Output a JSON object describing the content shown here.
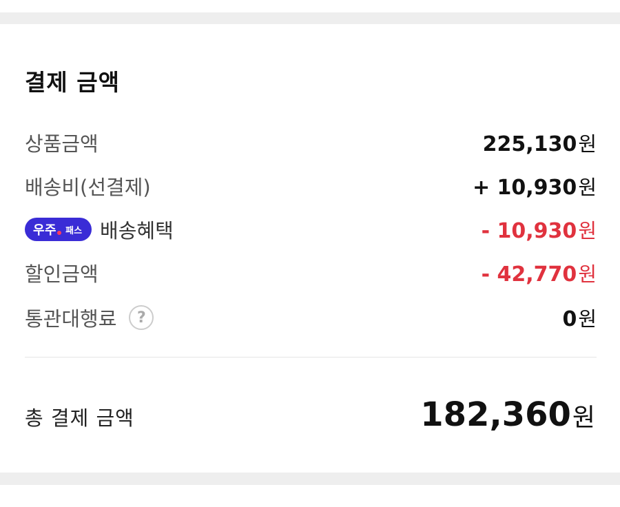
{
  "section_title": "결제 금액",
  "rows": [
    {
      "label": "상품금액",
      "amount": "225,130",
      "unit": "원"
    },
    {
      "label": "배송비(선결제)",
      "amount": "+ 10,930",
      "unit": "원"
    },
    {
      "badge": {
        "brand": "우주",
        "pass": "패스"
      },
      "label": "배송혜택",
      "amount": "- 10,930",
      "unit": "원"
    },
    {
      "label": "할인금액",
      "amount": "- 42,770",
      "unit": "원"
    },
    {
      "label": "통관대행료",
      "help": "?",
      "amount": "0",
      "unit": "원"
    }
  ],
  "total": {
    "label": "총 결제 금액",
    "amount": "182,360",
    "unit": "원"
  },
  "colors": {
    "discount": "#e0323e",
    "badge": "#3a2cd6",
    "badge_dot": "#ff3b5c"
  },
  "icons": {
    "help": "question-circle-icon"
  }
}
